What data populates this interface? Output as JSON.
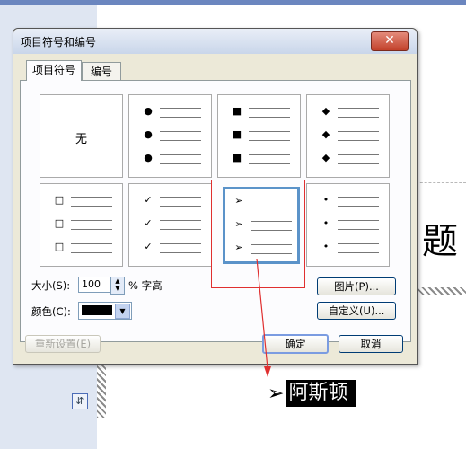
{
  "document": {
    "heading_char": "题",
    "bullet_arrow": "➢",
    "bullet_text": "阿斯顿",
    "anchor_glyph": "⇵"
  },
  "dialog": {
    "title": "项目符号和编号",
    "close_glyph": "✕",
    "tabs": [
      "项目符号",
      "编号"
    ],
    "none_label": "无",
    "gallery": [
      {
        "symbol": "",
        "name": "none"
      },
      {
        "symbol": "●",
        "name": "filled-circle"
      },
      {
        "symbol": "■",
        "name": "filled-square"
      },
      {
        "symbol": "◆",
        "name": "filled-diamond"
      },
      {
        "symbol": "□",
        "name": "hollow-square"
      },
      {
        "symbol": "✓",
        "name": "check"
      },
      {
        "symbol": "➢",
        "name": "arrow",
        "selected": true
      },
      {
        "symbol": "•",
        "name": "small-dot"
      }
    ],
    "size_label": "大小(S):",
    "size_value": "100",
    "size_unit": "% 字高",
    "color_label": "颜色(C):",
    "color_value": "#000000",
    "picture_button": "图片(P)...",
    "customize_button": "自定义(U)...",
    "reset_button": "重新设置(E)",
    "ok_button": "确定",
    "cancel_button": "取消"
  },
  "colors": {
    "selection_border": "#5b93c9",
    "annotation_red": "#e03030"
  }
}
